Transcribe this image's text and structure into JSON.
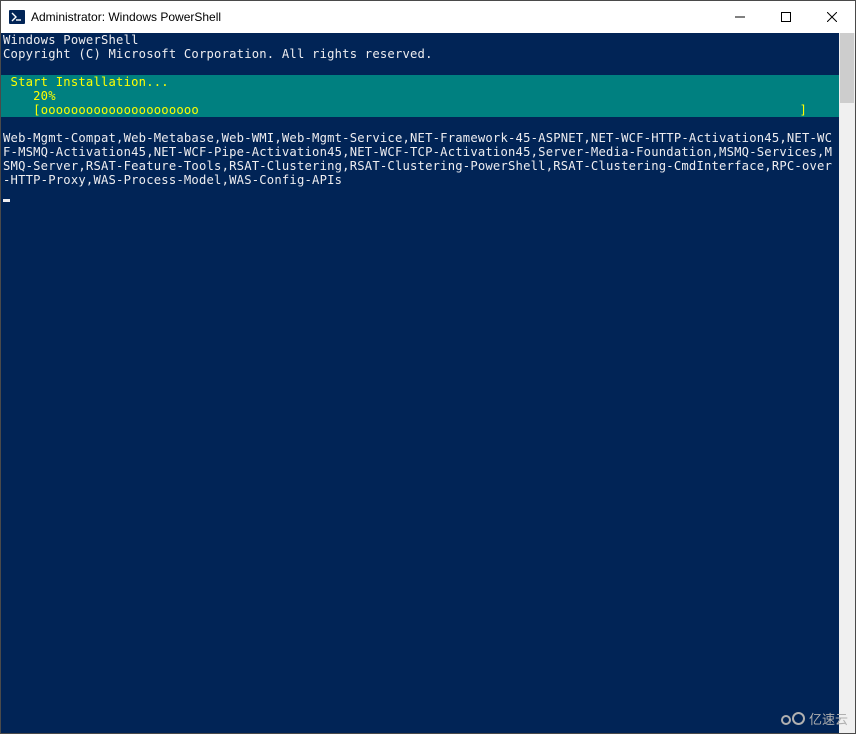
{
  "titlebar": {
    "title": "Administrator: Windows PowerShell"
  },
  "console": {
    "header_line1": "Windows PowerShell",
    "header_line2": "Copyright (C) Microsoft Corporation. All rights reserved."
  },
  "progress": {
    "title": " Start Installation...",
    "percent": "    20%",
    "bar_open": "    [",
    "bar_fill": "ooooooooooooooooooooo",
    "bar_close": "]"
  },
  "features": {
    "text": "Web-Mgmt-Compat,Web-Metabase,Web-WMI,Web-Mgmt-Service,NET-Framework-45-ASPNET,NET-WCF-HTTP-Activation45,NET-WCF-MSMQ-Activation45,NET-WCF-Pipe-Activation45,NET-WCF-TCP-Activation45,Server-Media-Foundation,MSMQ-Services,MSMQ-Server,RSAT-Feature-Tools,RSAT-Clustering,RSAT-Clustering-PowerShell,RSAT-Clustering-CmdInterface,RPC-over-HTTP-Proxy,WAS-Process-Model,WAS-Config-APIs"
  },
  "watermark": {
    "text": "亿速云"
  },
  "colors": {
    "console_bg": "#012456",
    "console_fg": "#eeedf0",
    "progress_bg": "#008080",
    "progress_fg": "#ffff00"
  }
}
